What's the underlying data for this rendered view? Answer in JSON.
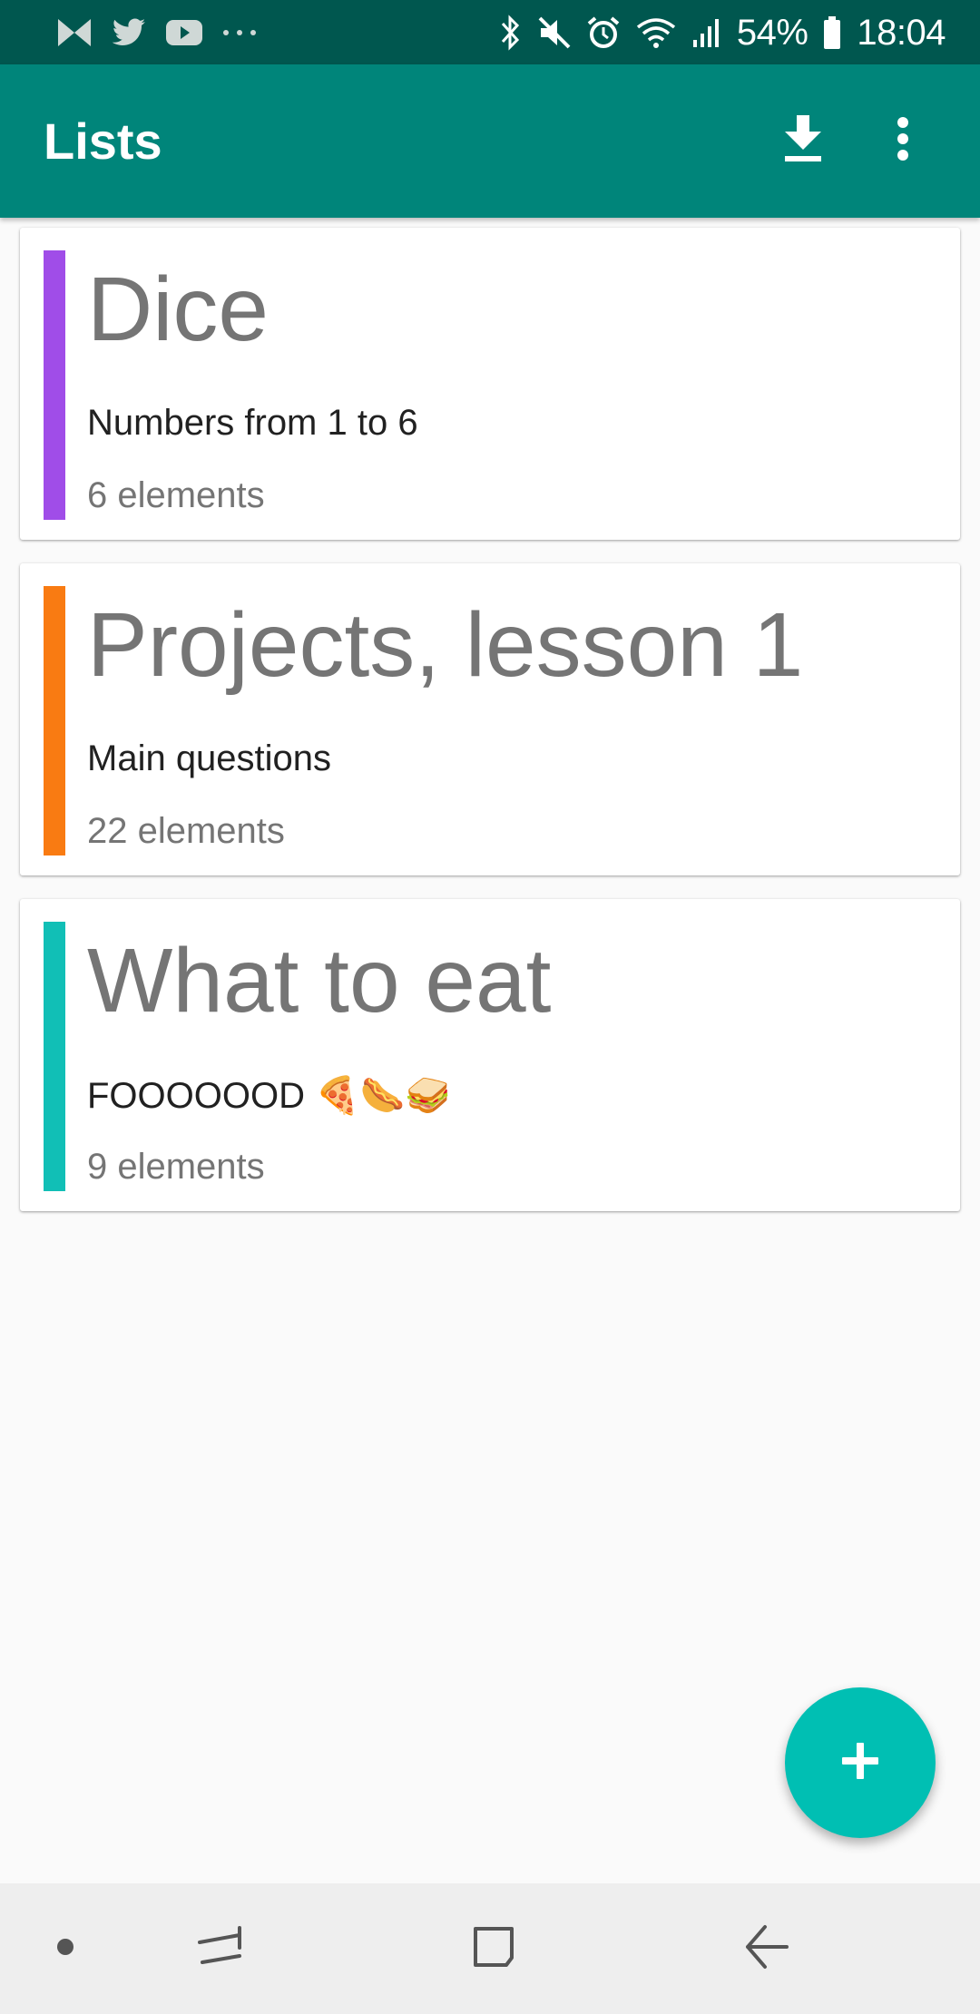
{
  "status_bar": {
    "battery_percent": "54%",
    "time": "18:04",
    "left_icons": [
      "notification-icon",
      "twitter-icon",
      "youtube-icon",
      "more-notifications-icon"
    ],
    "right_icons": [
      "bluetooth-icon",
      "mute-icon",
      "alarm-icon",
      "wifi-icon",
      "signal-icon",
      "battery-icon"
    ]
  },
  "app_bar": {
    "title": "Lists",
    "actions": [
      "download-icon",
      "overflow-menu-icon"
    ]
  },
  "lists": [
    {
      "title": "Dice",
      "description": "Numbers from 1 to 6",
      "count": "6 elements",
      "color": "#a04de8"
    },
    {
      "title": "Projects, lesson 1",
      "description": "Main questions",
      "count": "22 elements",
      "color": "#f97b12"
    },
    {
      "title": "What to eat",
      "description": "FOOOOOOD 🍕🌭🥪",
      "count": "9 elements",
      "color": "#11bfb6"
    }
  ],
  "fab": {
    "icon": "plus-icon",
    "color": "#00bfb3"
  },
  "nav_bar": {
    "items": [
      "dot-icon",
      "recents-icon",
      "home-icon",
      "back-icon"
    ]
  },
  "colors": {
    "status_bar": "#00574f",
    "app_bar": "#00857a",
    "background": "#fafafa"
  }
}
